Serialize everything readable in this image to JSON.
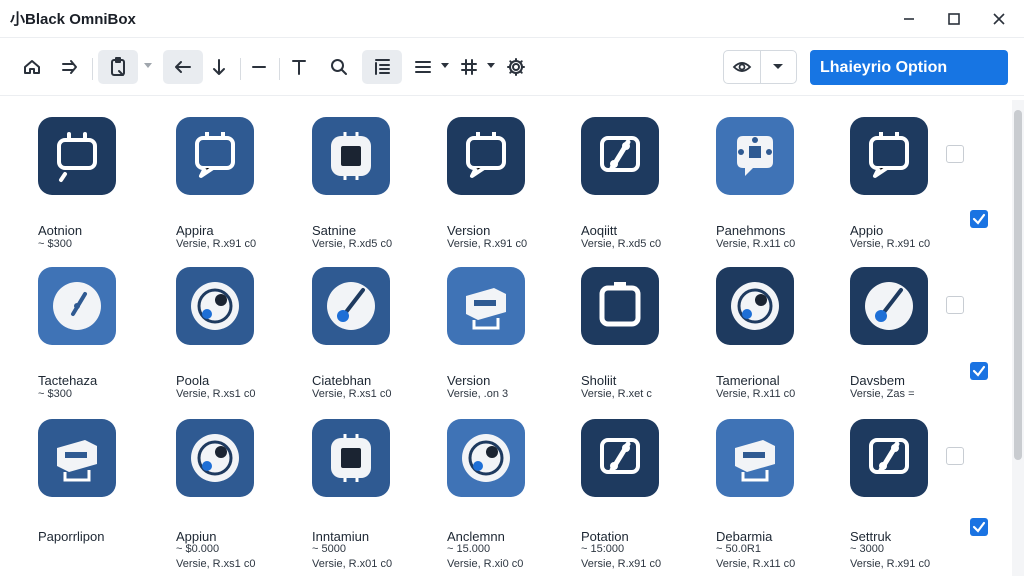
{
  "window": {
    "title": "小Black OmniBox"
  },
  "toolbar": {
    "items": [
      "home-icon",
      "forward-arrows-icon",
      "clipboard-icon",
      "back-arrow-icon",
      "down-arrow-icon",
      "minus-icon",
      "text-icon",
      "search-icon",
      "line-spacing-icon",
      "align-icon",
      "grid-icon",
      "gear-icon"
    ],
    "primary_label": "Lhaieyrio Option"
  },
  "colors": {
    "accent": "#1775e3",
    "tile_dark": "#1e3a5f",
    "tile_mid": "#2f5a92",
    "tile_light": "#3f73b6"
  },
  "grid": {
    "rows": [
      [
        {
          "name": "Aotnion",
          "meta": "~ $300",
          "color": "#1e3a5f",
          "icon": "monitor-icon"
        },
        {
          "name": "Appira",
          "meta": "Versie, R.x91 c0",
          "color": "#2f5a92",
          "icon": "chat-screen-icon"
        },
        {
          "name": "Satnine",
          "meta": "Versie, R.xd5 c0",
          "color": "#2f5a92",
          "icon": "chip-icon"
        },
        {
          "name": "Version",
          "meta": "Versie, R.x91 c0",
          "color": "#1e3a5f",
          "icon": "chat-screen-icon"
        },
        {
          "name": "Aoqiitt",
          "meta": "Versie, R.xd5 c0",
          "color": "#1e3a5f",
          "icon": "link-screen-icon"
        },
        {
          "name": "Panehmons",
          "meta": "Versie, R.x11 c0",
          "color": "#3f73b6",
          "icon": "network-chat-icon"
        },
        {
          "name": "Appio",
          "meta": "Versie, R.x91 c0",
          "color": "#1e3a5f",
          "icon": "chat-screen-icon"
        }
      ],
      [
        {
          "name": "Tactehaza",
          "meta": "~ $300",
          "color": "#3f73b6",
          "icon": "clock-icon"
        },
        {
          "name": "Poola",
          "meta": "Versie, R.xs1 c0",
          "color": "#2f5a92",
          "icon": "target-icon"
        },
        {
          "name": "Ciatebhan",
          "meta": "Versie, R.xs1 c0",
          "color": "#2f5a92",
          "icon": "compass-icon"
        },
        {
          "name": "Version",
          "meta": "Versie, .on 3",
          "color": "#3f73b6",
          "icon": "device-icon"
        },
        {
          "name": "Sholiit",
          "meta": "Versie, R.xet c",
          "color": "#1e3a5f",
          "icon": "window-icon"
        },
        {
          "name": "Tamerional",
          "meta": "Versie, R.x11 c0",
          "color": "#1e3a5f",
          "icon": "target-icon"
        },
        {
          "name": "Davsbem",
          "meta": "Versie, Zas =",
          "color": "#1e3a5f",
          "icon": "compass-icon"
        }
      ],
      [
        {
          "name": "Paporrlipon",
          "meta": "",
          "meta2": "",
          "color": "#2f5a92",
          "icon": "device-icon"
        },
        {
          "name": "Appiun",
          "meta": "~ $0.000",
          "meta2": "Versie, R.xs1 c0",
          "color": "#2f5a92",
          "icon": "target-icon"
        },
        {
          "name": "Inntamiun",
          "meta": "~ 5000",
          "meta2": "Versie, R.x01 c0",
          "color": "#2f5a92",
          "icon": "chip-icon"
        },
        {
          "name": "Anclemnn",
          "meta": "~ 15.000",
          "meta2": "Versie, R.xi0 c0",
          "color": "#3f73b6",
          "icon": "target-icon"
        },
        {
          "name": "Potation",
          "meta": "~ 15:000",
          "meta2": "Versie, R.x91 c0",
          "color": "#1e3a5f",
          "icon": "link-screen-icon"
        },
        {
          "name": "Debarmia",
          "meta": "~ 50.0R1",
          "meta2": "Versie, R.x11 c0",
          "color": "#3f73b6",
          "icon": "device-icon"
        },
        {
          "name": "Settruk",
          "meta": "~ 3000",
          "meta2": "Versie, R.x91 c0",
          "color": "#1e3a5f",
          "icon": "link-screen-icon"
        }
      ]
    ],
    "checkboxes": [
      false,
      true,
      false,
      true,
      false,
      true
    ]
  }
}
